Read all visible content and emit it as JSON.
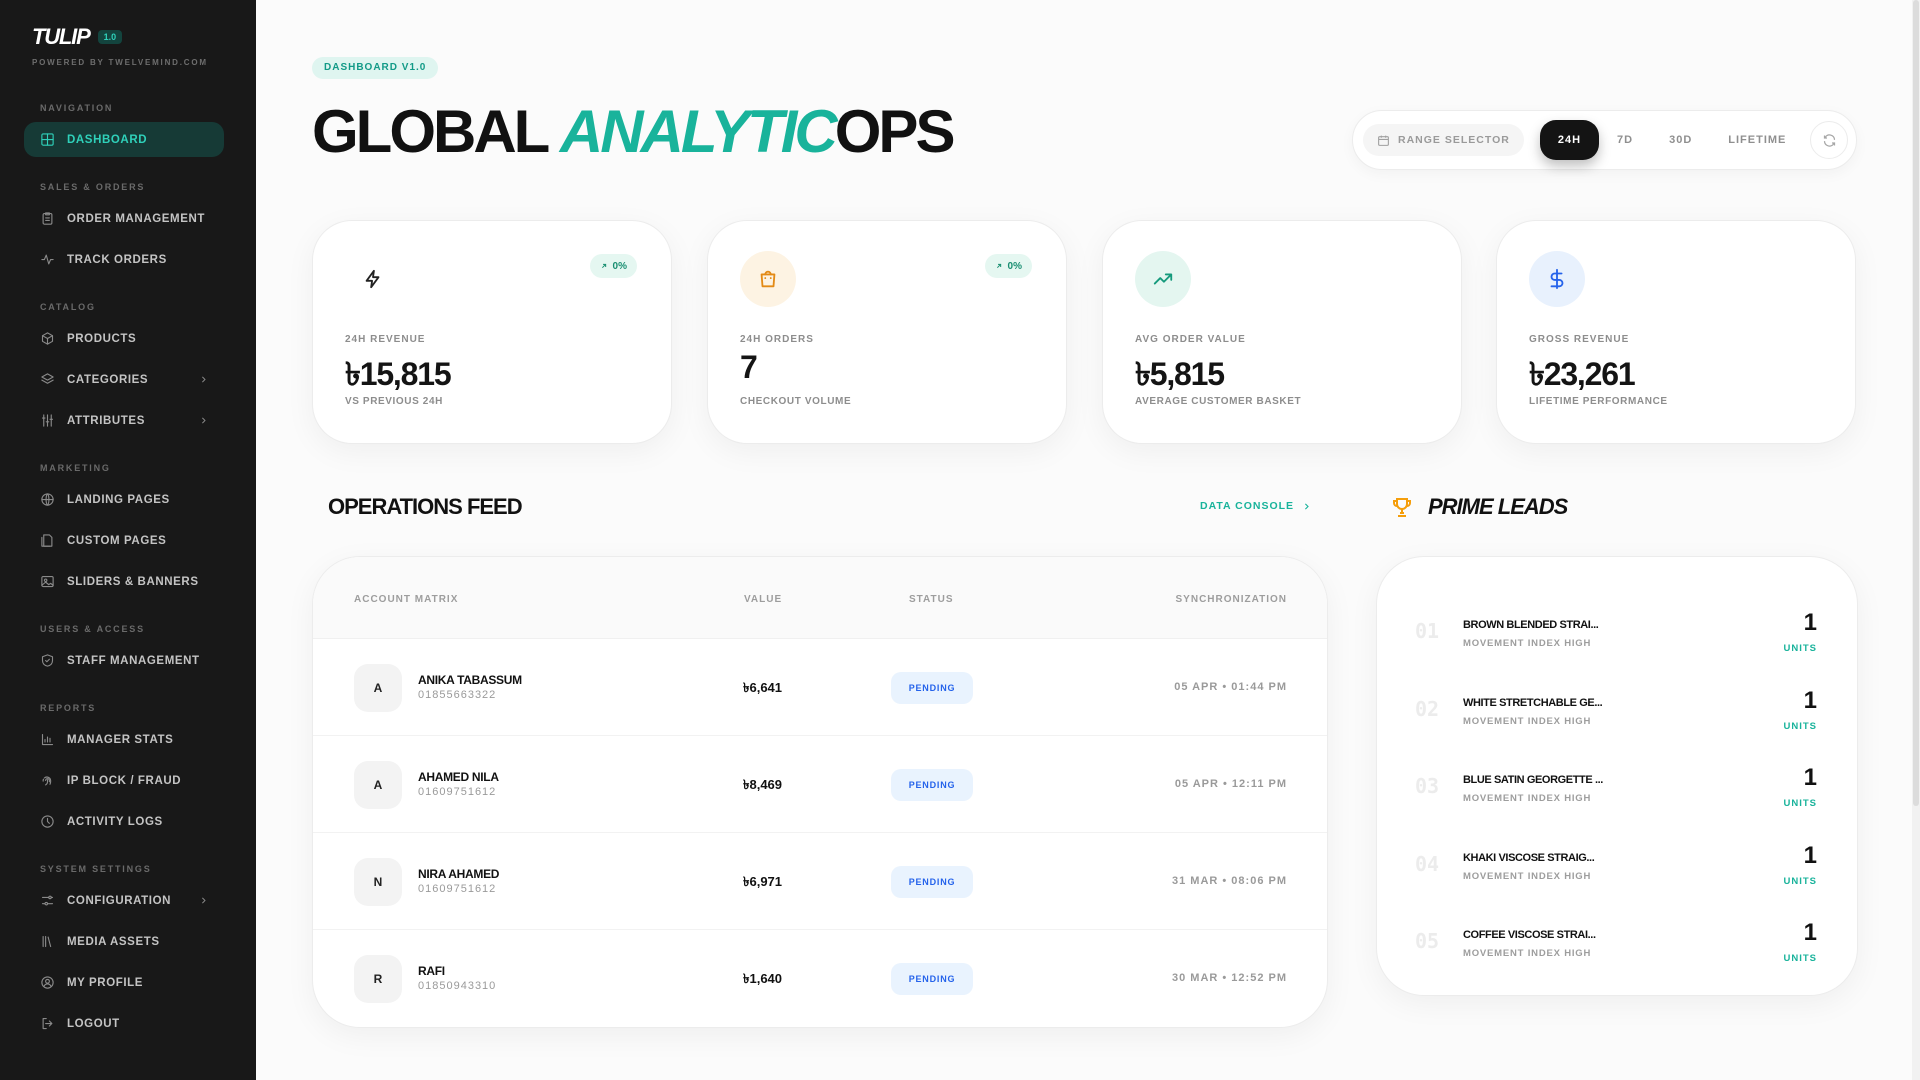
{
  "brand": {
    "name": "TULIP",
    "version": "1.0",
    "powered_by": "POWERED BY TWELVEMIND.COM"
  },
  "sidebar": {
    "sections": [
      {
        "title": "NAVIGATION",
        "items": [
          {
            "label": "DASHBOARD",
            "icon": "grid-icon",
            "active": true
          }
        ]
      },
      {
        "title": "SALES & ORDERS",
        "items": [
          {
            "label": "ORDER MANAGEMENT",
            "icon": "clipboard-icon"
          },
          {
            "label": "TRACK ORDERS",
            "icon": "activity-icon"
          }
        ]
      },
      {
        "title": "CATALOG",
        "items": [
          {
            "label": "PRODUCTS",
            "icon": "box-icon"
          },
          {
            "label": "CATEGORIES",
            "icon": "layers-icon",
            "expandable": true
          },
          {
            "label": "ATTRIBUTES",
            "icon": "sliders-icon",
            "expandable": true
          }
        ]
      },
      {
        "title": "MARKETING",
        "items": [
          {
            "label": "LANDING PAGES",
            "icon": "globe-icon"
          },
          {
            "label": "CUSTOM PAGES",
            "icon": "page-icon"
          },
          {
            "label": "SLIDERS & BANNERS",
            "icon": "image-icon"
          }
        ]
      },
      {
        "title": "USERS & ACCESS",
        "items": [
          {
            "label": "STAFF MANAGEMENT",
            "icon": "shield-icon"
          }
        ]
      },
      {
        "title": "REPORTS",
        "items": [
          {
            "label": "MANAGER STATS",
            "icon": "bar-chart-icon"
          },
          {
            "label": "IP BLOCK / FRAUD",
            "icon": "fingerprint-icon"
          },
          {
            "label": "ACTIVITY LOGS",
            "icon": "clock-icon"
          }
        ]
      },
      {
        "title": "SYSTEM SETTINGS",
        "items": [
          {
            "label": "CONFIGURATION",
            "icon": "settings-sliders-icon",
            "expandable": true
          },
          {
            "label": "MEDIA ASSETS",
            "icon": "library-icon"
          },
          {
            "label": "MY PROFILE",
            "icon": "user-circle-icon"
          },
          {
            "label": "LOGOUT",
            "icon": "logout-icon"
          }
        ]
      }
    ]
  },
  "header": {
    "badge": "DASHBOARD V1.0",
    "title_part1": "GLOBAL ",
    "title_accent": "ANALYTIC",
    "title_part2": "OPS"
  },
  "range": {
    "label": "RANGE SELECTOR",
    "options": [
      "24H",
      "7D",
      "30D",
      "LIFETIME"
    ],
    "active": "24H"
  },
  "kpis": [
    {
      "label": "24H REVENUE",
      "value": "৳15,815",
      "sub": "VS PREVIOUS 24H",
      "icon": "zap-icon",
      "icon_color": "#222222",
      "icon_bg": "#ffffff",
      "trend": "0%"
    },
    {
      "label": "24H ORDERS",
      "value": "7",
      "sub": "CHECKOUT VOLUME",
      "icon": "shopping-bag-icon",
      "icon_color": "#e38a16",
      "icon_bg": "#fdf3e3",
      "trend": "0%"
    },
    {
      "label": "AVG ORDER VALUE",
      "value": "৳5,815",
      "sub": "AVERAGE CUSTOMER BASKET",
      "icon": "trending-up-icon",
      "icon_color": "#159a7c",
      "icon_bg": "#e4f6f0"
    },
    {
      "label": "GROSS REVENUE",
      "value": "৳23,261",
      "sub": "LIFETIME PERFORMANCE",
      "icon": "dollar-icon",
      "icon_color": "#2563eb",
      "icon_bg": "#e8f1fd"
    }
  ],
  "operations": {
    "title": "OPERATIONS FEED",
    "console_link": "DATA CONSOLE",
    "columns": {
      "account": "ACCOUNT MATRIX",
      "value": "VALUE",
      "status": "STATUS",
      "sync": "SYNCHRONIZATION"
    },
    "rows": [
      {
        "initial": "A",
        "name": "ANIKA TABASSUM",
        "phone": "01855663322",
        "value": "৳6,641",
        "status": "PENDING",
        "sync": "05 APR • 01:44 PM"
      },
      {
        "initial": "A",
        "name": "AHAMED NILA",
        "phone": "01609751612",
        "value": "৳8,469",
        "status": "PENDING",
        "sync": "05 APR • 12:11 PM"
      },
      {
        "initial": "N",
        "name": "NIRA AHAMED",
        "phone": "01609751612",
        "value": "৳6,971",
        "status": "PENDING",
        "sync": "31 MAR • 08:06 PM"
      },
      {
        "initial": "R",
        "name": "RAFI",
        "phone": "01850943310",
        "value": "৳1,640",
        "status": "PENDING",
        "sync": "30 MAR • 12:52 PM"
      }
    ]
  },
  "prime_leads": {
    "title": "PRIME LEADS",
    "items": [
      {
        "index": "01",
        "name": "BROWN BLENDED STRAI...",
        "sub": "MOVEMENT INDEX HIGH",
        "value": "1",
        "unit": "UNITS"
      },
      {
        "index": "02",
        "name": "WHITE STRETCHABLE GE...",
        "sub": "MOVEMENT INDEX HIGH",
        "value": "1",
        "unit": "UNITS"
      },
      {
        "index": "03",
        "name": "BLUE SATIN GEORGETTE ...",
        "sub": "MOVEMENT INDEX HIGH",
        "value": "1",
        "unit": "UNITS"
      },
      {
        "index": "04",
        "name": "KHAKI VISCOSE STRAIG...",
        "sub": "MOVEMENT INDEX HIGH",
        "value": "1",
        "unit": "UNITS"
      },
      {
        "index": "05",
        "name": "COFFEE VISCOSE STRAI...",
        "sub": "MOVEMENT INDEX HIGH",
        "value": "1",
        "unit": "UNITS"
      }
    ]
  },
  "colors": {
    "accent": "#19b39b",
    "sidebar_bg": "#181818",
    "active_nav_bg": "#163a36",
    "status_pending": "#2563eb"
  }
}
